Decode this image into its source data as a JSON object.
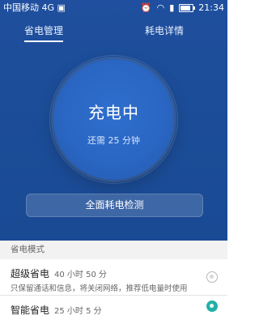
{
  "status_bar": {
    "carrier": "中国移动 4G",
    "time": "21:34",
    "icons": [
      "image-icon",
      "alarm-icon",
      "wifi-icon",
      "signal-4g-icon",
      "battery-icon"
    ]
  },
  "tabs": [
    {
      "label": "省电管理",
      "active": true
    },
    {
      "label": "耗电详情",
      "active": false
    }
  ],
  "charging": {
    "title": "充电中",
    "subtitle": "还需 25 分钟"
  },
  "actions": {
    "check_label": "全面耗电检测"
  },
  "section": {
    "label": "省电模式"
  },
  "modes": [
    {
      "name": "超级省电",
      "time": "40 小时 50 分",
      "desc": "只保留通话和信息，将关闭网络，推荐低电量时使用",
      "selected": false
    },
    {
      "name": "智能省电",
      "time": "25 小时 5 分",
      "desc": "",
      "selected": true
    }
  ],
  "colors": {
    "header_blue": "#1c4d98",
    "accent_teal": "#21b2a6"
  }
}
